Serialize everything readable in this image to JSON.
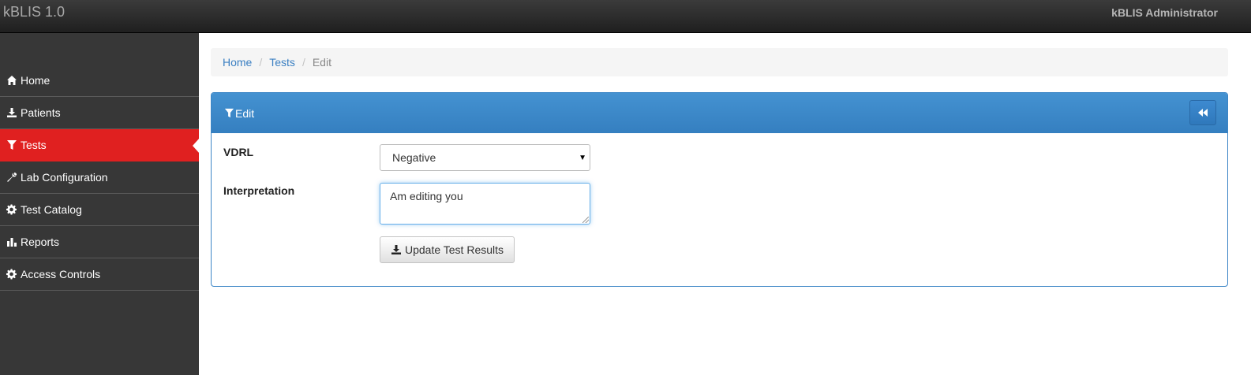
{
  "app": {
    "title": "kBLIS 1.0",
    "user": "kBLIS Administrator"
  },
  "sidebar": {
    "items": [
      {
        "label": "Home",
        "icon": "home-icon"
      },
      {
        "label": "Patients",
        "icon": "download-icon"
      },
      {
        "label": "Tests",
        "icon": "filter-icon",
        "active": true
      },
      {
        "label": "Lab Configuration",
        "icon": "wrench-icon"
      },
      {
        "label": "Test Catalog",
        "icon": "gear-icon"
      },
      {
        "label": "Reports",
        "icon": "bar-chart-icon"
      },
      {
        "label": "Access Controls",
        "icon": "gear-icon"
      }
    ]
  },
  "breadcrumb": {
    "home": "Home",
    "tests": "Tests",
    "current": "Edit"
  },
  "panel": {
    "title": "Edit",
    "fields": {
      "vdrl_label": "VDRL",
      "vdrl_value": "Negative",
      "interpretation_label": "Interpretation",
      "interpretation_value": "Am editing you"
    },
    "update_label": "Update Test Results"
  },
  "colors": {
    "active": "#e02020",
    "primary": "#3a85c6",
    "sidebar": "#373737"
  }
}
